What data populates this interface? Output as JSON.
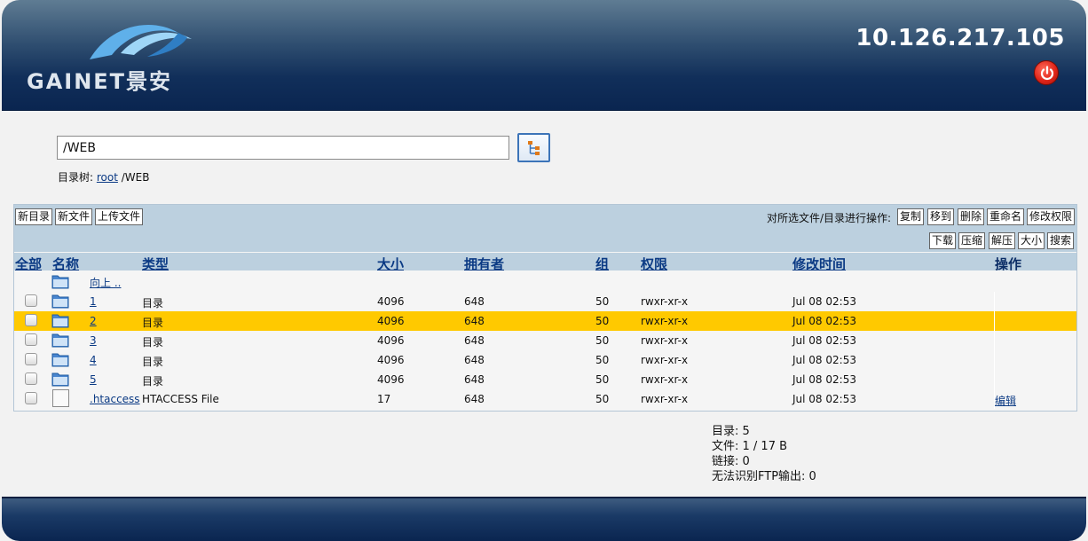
{
  "header": {
    "logo_text": "GAINET景安",
    "ip": "10.126.217.105",
    "power_icon": "power-icon"
  },
  "path": {
    "value": "/WEB",
    "breadcrumb_label": "目录树:",
    "breadcrumb_root": "root",
    "breadcrumb_current": "/WEB"
  },
  "toolbar": {
    "new_dir": "新目录",
    "new_file": "新文件",
    "upload": "上传文件",
    "op_label": "对所选文件/目录进行操作:",
    "copy": "复制",
    "move": "移到",
    "delete": "删除",
    "rename": "重命名",
    "chmod": "修改权限",
    "download": "下载",
    "compress": "压缩",
    "extract": "解压",
    "size": "大小",
    "search": "搜索"
  },
  "columns": {
    "all": "全部",
    "name": "名称",
    "type": "类型",
    "size": "大小",
    "owner": "拥有者",
    "group": "组",
    "perms": "权限",
    "mtime": "修改时间",
    "action": "操作"
  },
  "up_link": "向上 ..",
  "rows": [
    {
      "name": "1",
      "type": "目录",
      "size": "4096",
      "owner": "648",
      "group": "50",
      "perms": "rwxr-xr-x",
      "mtime": "Jul 08 02:53",
      "action": ""
    },
    {
      "name": "2",
      "type": "目录",
      "size": "4096",
      "owner": "648",
      "group": "50",
      "perms": "rwxr-xr-x",
      "mtime": "Jul 08 02:53",
      "action": ""
    },
    {
      "name": "3",
      "type": "目录",
      "size": "4096",
      "owner": "648",
      "group": "50",
      "perms": "rwxr-xr-x",
      "mtime": "Jul 08 02:53",
      "action": ""
    },
    {
      "name": "4",
      "type": "目录",
      "size": "4096",
      "owner": "648",
      "group": "50",
      "perms": "rwxr-xr-x",
      "mtime": "Jul 08 02:53",
      "action": ""
    },
    {
      "name": "5",
      "type": "目录",
      "size": "4096",
      "owner": "648",
      "group": "50",
      "perms": "rwxr-xr-x",
      "mtime": "Jul 08 02:53",
      "action": ""
    },
    {
      "name": ".htaccess",
      "type": "HTACCESS File",
      "size": "17",
      "owner": "648",
      "group": "50",
      "perms": "rwxr-xr-x",
      "mtime": "Jul 08 02:53",
      "action": "编辑"
    }
  ],
  "stats": {
    "dirs": "目录: 5",
    "files": "文件: 1 / 17 B",
    "links": "链接: 0",
    "unknown": "无法识别FTP输出: 0"
  },
  "colors": {
    "header_dark": "#0a2550",
    "toolbar_bg": "#bcd0df",
    "selected_row": "#ffc900",
    "link": "#0b3a84"
  }
}
